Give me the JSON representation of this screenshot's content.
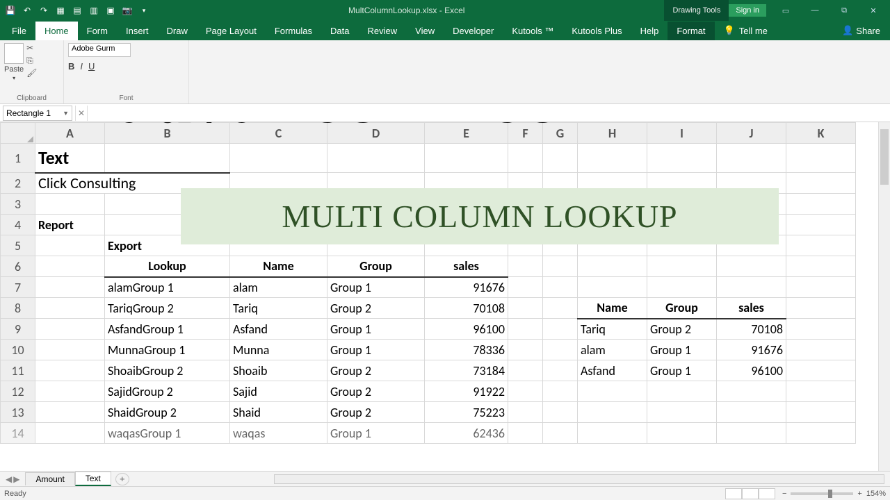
{
  "titlebar": {
    "filename": "MultColumnLookup.xlsx - Excel",
    "context_tab": "Drawing Tools",
    "signin": "Sign in"
  },
  "tabs": {
    "file": "File",
    "home": "Home",
    "form": "Form",
    "insert": "Insert",
    "draw": "Draw",
    "pagelayout": "Page Layout",
    "formulas": "Formulas",
    "data": "Data",
    "review": "Review",
    "view": "View",
    "developer": "Developer",
    "kutools": "Kutools ™",
    "kutoolsplus": "Kutools Plus",
    "help": "Help",
    "format": "Format",
    "tellme": "Tell me",
    "share": "Share"
  },
  "ribbon": {
    "clipboard_label": "Clipboard",
    "font_label": "Font",
    "paste": "Paste",
    "fontname": "Adobe Gurm"
  },
  "namebox": "Rectangle 1",
  "overlay": {
    "title": "advance Excel",
    "subtitle": "MULTI COLUMN LOOKUP"
  },
  "columns": [
    "A",
    "B",
    "C",
    "D",
    "E",
    "F",
    "G",
    "H",
    "I",
    "J",
    "K"
  ],
  "rows": [
    "1",
    "2",
    "3",
    "4",
    "5",
    "6",
    "7",
    "8",
    "9",
    "10",
    "11",
    "12",
    "13",
    "14"
  ],
  "cells": {
    "A1": "Text",
    "A2": "Click Consulting",
    "A4": "Report",
    "B5": "Export",
    "B6": "Lookup",
    "C6": "Name",
    "D6": "Group",
    "E6": "sales",
    "B7": "alamGroup 1",
    "C7": "alam",
    "D7": "Group 1",
    "E7": "91676",
    "B8": "TariqGroup 2",
    "C8": "Tariq",
    "D8": "Group 2",
    "E8": "70108",
    "B9": "AsfandGroup 1",
    "C9": "Asfand",
    "D9": "Group 1",
    "E9": "96100",
    "B10": "MunnaGroup 1",
    "C10": "Munna",
    "D10": "Group 1",
    "E10": "78336",
    "B11": "ShoaibGroup 2",
    "C11": "Shoaib",
    "D11": "Group 2",
    "E11": "73184",
    "B12": "SajidGroup 2",
    "C12": "Sajid",
    "D12": "Group 2",
    "E12": "91922",
    "B13": "ShaidGroup 2",
    "C13": "Shaid",
    "D13": "Group 2",
    "E13": "75223",
    "B14": "waqasGroup 1",
    "C14": "waqas",
    "D14": "Group 1",
    "E14": "62436",
    "H8": "Name",
    "I8": "Group",
    "J8": "sales",
    "H9": "Tariq",
    "I9": "Group 2",
    "J9": "70108",
    "H10": "alam",
    "I10": "Group 1",
    "J10": "91676",
    "H11": "Asfand",
    "I11": "Group 1",
    "J11": "96100"
  },
  "sheets": {
    "amount": "Amount",
    "text": "Text"
  },
  "status": {
    "ready": "Ready",
    "zoom": "154%"
  }
}
